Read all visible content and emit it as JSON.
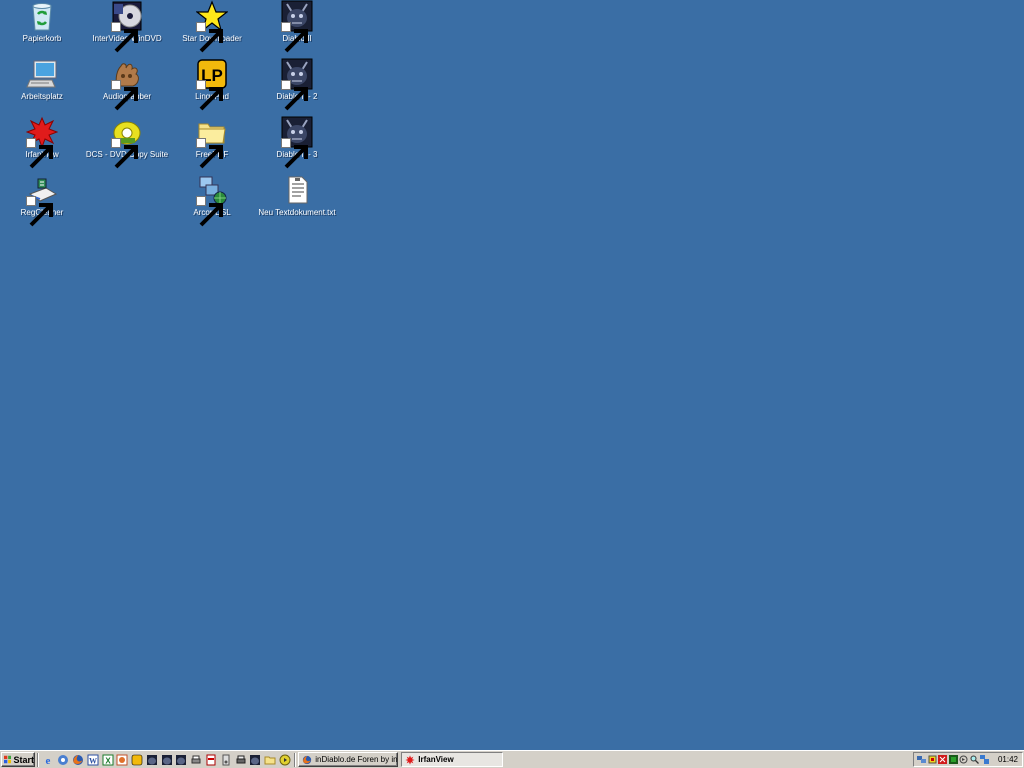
{
  "desktop": {
    "background": "#3a6ea5",
    "icons": [
      {
        "id": "papierkorb",
        "label": "Papierkorb",
        "icon": "recycle-bin-icon"
      },
      {
        "id": "intervideo",
        "label": "InterVideo WinDVD",
        "icon": "dvd-player-icon"
      },
      {
        "id": "stardownloader",
        "label": "Star Downloader",
        "icon": "star-icon"
      },
      {
        "id": "diablo1",
        "label": "Diablo II",
        "icon": "diablo-icon"
      },
      {
        "id": "arbeitsplatz",
        "label": "Arbeitsplatz",
        "icon": "my-computer-icon"
      },
      {
        "id": "audiograbber",
        "label": "Audiograbber",
        "icon": "audiograbber-icon"
      },
      {
        "id": "lingopad",
        "label": "LingoPad",
        "icon": "lingopad-icon"
      },
      {
        "id": "diablo2",
        "label": "Diablo II - 2",
        "icon": "diablo-icon"
      },
      {
        "id": "irfanview",
        "label": "IrfanView",
        "icon": "irfanview-icon"
      },
      {
        "id": "dcs",
        "label": "DCS - DVD Copy Suite",
        "icon": "dvd-copy-icon"
      },
      {
        "id": "freepdf",
        "label": "FreePDF",
        "icon": "folder-icon"
      },
      {
        "id": "diablo3",
        "label": "Diablo II - 3",
        "icon": "diablo-icon"
      },
      {
        "id": "regcleaner",
        "label": "RegCleaner",
        "icon": "regcleaner-icon"
      },
      {
        "id": "arcordsl",
        "label": "Arcor-DSL",
        "icon": "network-icon"
      },
      {
        "id": "textdoc",
        "label": "Neu Textdokument.txt",
        "icon": "text-document-icon"
      }
    ]
  },
  "taskbar": {
    "start_label": "Start",
    "quick_launch": [
      "internet-explorer-icon",
      "outlook-icon",
      "firefox-icon",
      "word-icon",
      "excel-icon",
      "powerpoint-icon",
      "lingopad-icon",
      "diablo-icon",
      "diablo-icon",
      "diablo-icon",
      "printer-icon",
      "pdf-icon",
      "device-icon",
      "printer-icon",
      "diablo-icon",
      "folder-icon",
      "media-player-icon"
    ],
    "tasks": [
      {
        "label": "inDiablo.de Foren by inG...",
        "icon": "firefox-icon",
        "active": false
      },
      {
        "label": "IrfanView",
        "icon": "irfanview-icon",
        "active": true
      }
    ],
    "tray_icons": [
      "network-tray-icon",
      "antivirus-tray-icon",
      "irfanview-tray-icon",
      "monitor-tray-icon",
      "sound-tray-icon",
      "search-tray-icon",
      "network-connection-tray-icon"
    ],
    "clock": "01:42"
  }
}
